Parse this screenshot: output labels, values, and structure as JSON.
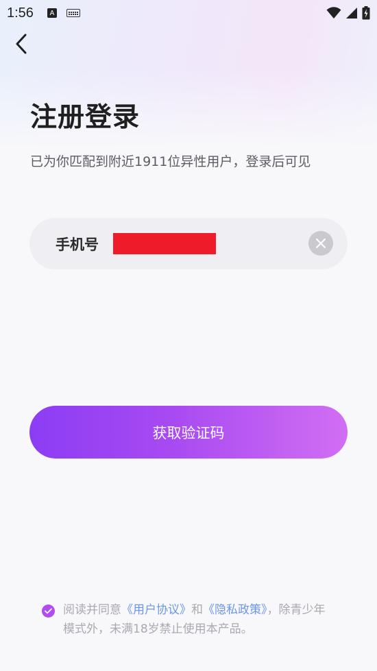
{
  "status_bar": {
    "time": "1:56",
    "input_indicator": "A"
  },
  "header": {
    "title": "注册登录",
    "subtitle": "已为你匹配到附近1911位异性用户，登录后可见"
  },
  "phone_field": {
    "label": "手机号",
    "value_redacted": true
  },
  "actions": {
    "get_code_label": "获取验证码"
  },
  "agreement": {
    "checked": true,
    "prefix": "阅读并同意",
    "user_agreement": "《用户协议》",
    "conjunction": "和",
    "privacy_policy": "《隐私政策》",
    "suffix": "，除青少年模式外，未满18岁禁止使用本产品。"
  },
  "colors": {
    "accent_start": "#8c3df4",
    "accent_end": "#d26ef3",
    "link": "#6c96e8",
    "redaction": "#ee1c2a"
  },
  "icons": [
    "back-arrow-icon",
    "clear-icon",
    "check-icon",
    "wifi-icon",
    "signal-icon",
    "battery-icon",
    "keyboard-icon"
  ]
}
